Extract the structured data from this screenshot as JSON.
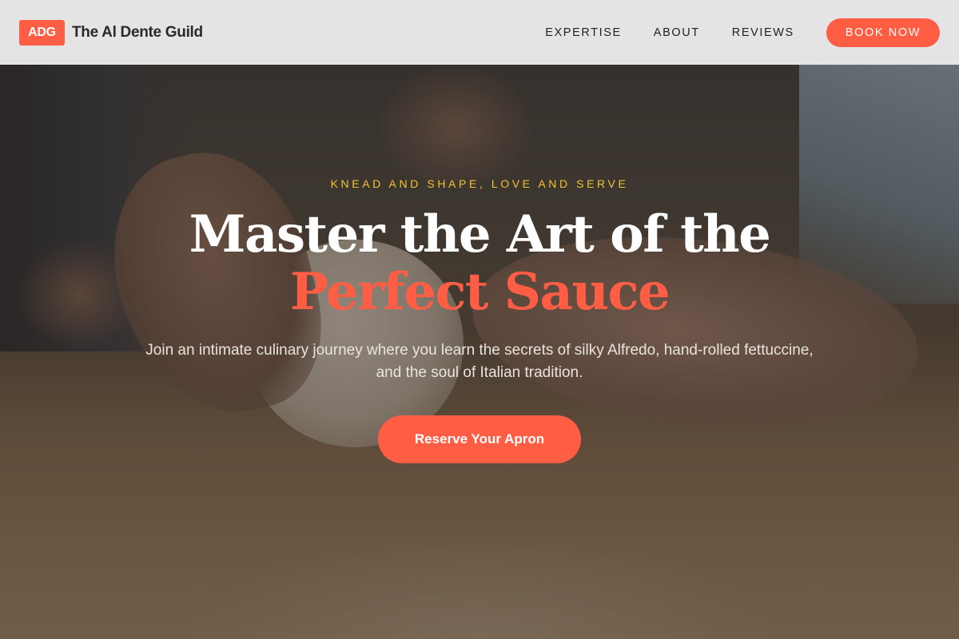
{
  "brand": {
    "badge": "ADG",
    "name": "The Al Dente Guild"
  },
  "nav": {
    "links": [
      "EXPERTISE",
      "ABOUT",
      "REVIEWS"
    ],
    "book_label": "BOOK NOW"
  },
  "hero": {
    "eyebrow": "KNEAD AND SHAPE, LOVE AND SERVE",
    "headline_line1": "Master the Art of the",
    "headline_line2": "Perfect Sauce",
    "subtitle": "Join an intimate culinary journey where you learn the secrets of silky Alfredo, hand-rolled fettuccine, and the soul of Italian tradition.",
    "cta_label": "Reserve Your Apron",
    "background_image": "hands kneading dough on floured wooden table"
  },
  "colors": {
    "accent": "#ff5e45",
    "eyebrow": "#f2c230",
    "header_bg": "#eeeeee",
    "headline": "#ffffff"
  }
}
